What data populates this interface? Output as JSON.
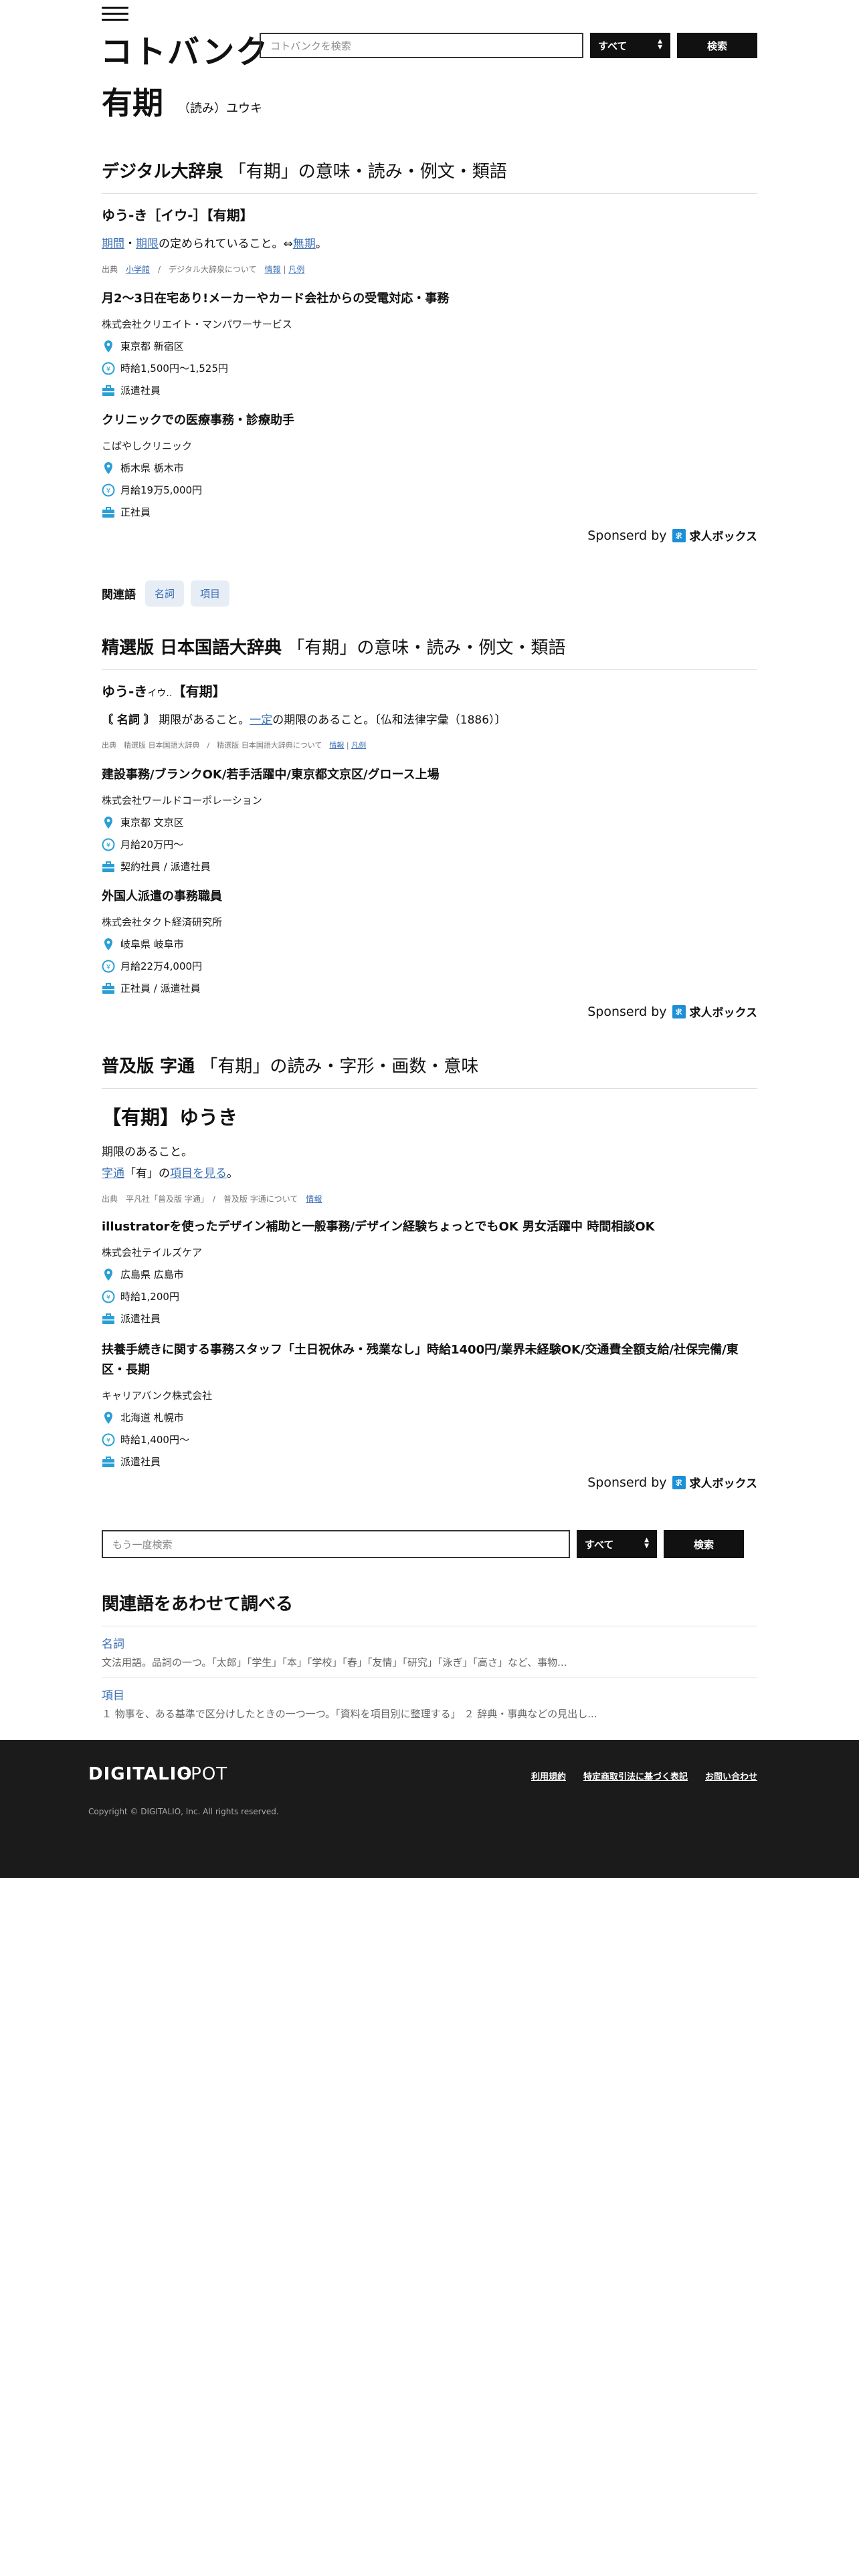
{
  "header": {
    "logo": "コトバンク",
    "search_placeholder": "コトバンクを検索",
    "select": "すべて",
    "search_button": "検索"
  },
  "headword": {
    "word": "有期",
    "yomi": "（読み）ユウキ"
  },
  "sections": [
    {
      "dict": "デジタル大辞泉",
      "title_rest": "「有期」の意味・読み・例文・類語",
      "entry": "ゆう‐き［イウ‐］【有期】",
      "def_link1": "期間",
      "def_sep": "・",
      "def_link2": "期限",
      "def_mid": "の定められていること。⇔",
      "def_link3": "無期",
      "def_end": "。",
      "source_pre": "出典",
      "source_pub": "小学館",
      "source_about": "デジタル大辞泉について",
      "source_info": "情報",
      "source_ex": "凡例",
      "jobs": [
        {
          "title": "月2〜3日在宅あり!メーカーやカード会社からの受電対応・事務",
          "company": "株式会社クリエイト・マンパワーサービス",
          "loc": "東京都 新宿区",
          "pay": "時給1,500円〜1,525円",
          "type": "派遣社員"
        },
        {
          "title": "クリニックでの医療事務・診療助手",
          "company": "こばやしクリニック",
          "loc": "栃木県 栃木市",
          "pay": "月給19万5,000円",
          "type": "正社員"
        }
      ],
      "sponsor": "Sponserd by",
      "sponsor_brand": "求人ボックス"
    },
    {
      "dict": "精選版 日本国語大辞典",
      "title_rest": "「有期」の意味・読み・例文・類語",
      "entry": "ゆう‐き",
      "entry_small": "イウ‥",
      "entry_end": "【有期】",
      "pos": "〘 名詞 〙",
      "def_pre": "期限があること。",
      "def_link": "一定",
      "def_post": "の期限のあること。〔仏和法律字彙（1886）〕",
      "source_pre": "出典",
      "source_pub": "精選版 日本国語大辞典",
      "source_about": "精選版 日本国語大辞典について",
      "source_info": "情報",
      "source_ex": "凡例",
      "jobs": [
        {
          "title": "建設事務/ブランクOK/若手活躍中/東京都文京区/グロース上場",
          "company": "株式会社ワールドコーポレーション",
          "loc": "東京都 文京区",
          "pay": "月給20万円〜",
          "type": "契約社員 / 派遣社員"
        },
        {
          "title": "外国人派遣の事務職員",
          "company": "株式会社タクト経済研究所",
          "loc": "岐阜県 岐阜市",
          "pay": "月給22万4,000円",
          "type": "正社員 / 派遣社員"
        }
      ],
      "sponsor": "Sponserd by",
      "sponsor_brand": "求人ボックス"
    },
    {
      "dict": "普及版 字通",
      "title_rest": "「有期」の読み・字形・画数・意味",
      "entry": "【有期】ゆうき",
      "def1": "期限のあること。",
      "ref_link1": "字通",
      "ref_mid": "「有」の",
      "ref_link2": "項目を見る",
      "ref_end": "。",
      "source_pre": "出典",
      "source_pub": "平凡社「普及版 字通」",
      "source_about": "普及版 字通について",
      "source_info": "情報",
      "jobs": [
        {
          "title": "illustratorを使ったデザイン補助と一般事務/デザイン経験ちょっとでもOK 男女活躍中 時間相談OK",
          "company": "株式会社テイルズケア",
          "loc": "広島県 広島市",
          "pay": "時給1,200円",
          "type": "派遣社員"
        },
        {
          "title": "扶養手続きに関する事務スタッフ「土日祝休み・残業なし」時給1400円/業界未経験OK/交通費全額支給/社保完備/東区・長期",
          "company": "キャリアバンク株式会社",
          "loc": "北海道 札幌市",
          "pay": "時給1,400円〜",
          "type": "派遣社員"
        }
      ],
      "sponsor": "Sponserd by",
      "sponsor_brand": "求人ボックス"
    }
  ],
  "related_tags": {
    "label": "関連語",
    "items": [
      "名詞",
      "項目"
    ]
  },
  "bottom_search": {
    "placeholder": "もう一度検索",
    "select": "すべて",
    "button": "検索"
  },
  "related_section": {
    "title": "関連語をあわせて調べる",
    "items": [
      {
        "name": "名詞",
        "desc": "文法用語。品詞の一つ。「太郎」「学生」「本」「学校」「春」「友情」「研究」「泳ぎ」「高さ」など、事物..."
      },
      {
        "name": "項目",
        "desc": "１ 物事を、ある基準で区分けしたときの一つ一つ。「資料を項目別に整理する」 ２ 辞典・事典などの見出し..."
      }
    ]
  },
  "footer": {
    "logo1": "DIGITALIO",
    "logo2": "GPOT",
    "links": [
      "利用規約",
      "特定商取引法に基づく表記",
      "お問い合わせ"
    ],
    "copyright": "Copyright © DIGITALIO, Inc. All rights reserved."
  },
  "colors": {
    "accent": "#3b6fb6",
    "icon": "#2a9fd6",
    "dark": "#111111",
    "footer": "#1b1b1b"
  }
}
